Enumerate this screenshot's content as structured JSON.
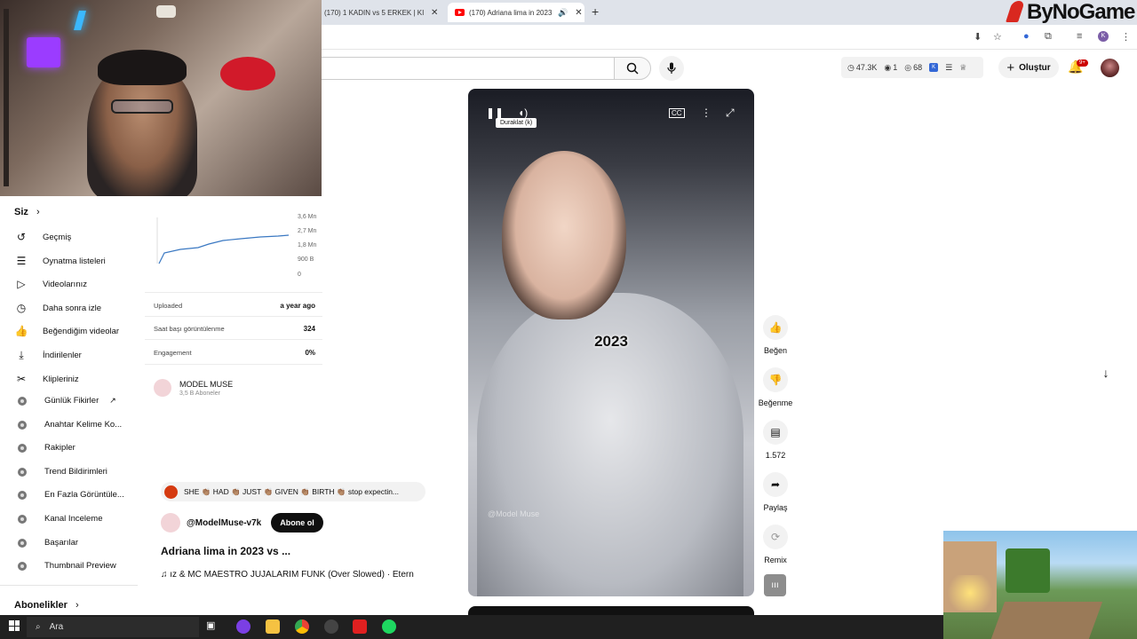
{
  "browser": {
    "tabs": [
      {
        "label": "(170) 1 KADIN vs 5 ERKEK | KIYA"
      },
      {
        "label": "(170) Adriana lima in 2023"
      }
    ],
    "new_tab": "+",
    "brand": "ByNoGame"
  },
  "header": {
    "stats": {
      "views": "47.3K",
      "a": "1",
      "b": "68"
    },
    "create_label": "Oluştur",
    "notif_badge": "9+"
  },
  "sidebar": {
    "you_label": "Siz",
    "items": [
      {
        "label": "Geçmiş",
        "icon": "history-icon"
      },
      {
        "label": "Oynatma listeleri",
        "icon": "playlist-icon"
      },
      {
        "label": "Videolarınız",
        "icon": "video-icon"
      },
      {
        "label": "Daha sonra izle",
        "icon": "clock-icon"
      },
      {
        "label": "Beğendiğim videolar",
        "icon": "thumbs-up-icon"
      },
      {
        "label": "İndirilenler",
        "icon": "download-icon"
      },
      {
        "label": "Klipleriniz",
        "icon": "scissors-icon"
      }
    ],
    "ext_items": [
      {
        "label": "Günlük Fikirler"
      },
      {
        "label": "Anahtar Kelime Ko..."
      },
      {
        "label": "Rakipler"
      },
      {
        "label": "Trend Bildirimleri"
      },
      {
        "label": "En Fazla Görüntüle..."
      },
      {
        "label": "Kanal Inceleme"
      },
      {
        "label": "Başarılar"
      },
      {
        "label": "Thumbnail Preview"
      }
    ],
    "subs_label": "Abonelikler"
  },
  "panel": {
    "chart_ticks": [
      "3,6 Mn",
      "2,7 Mn",
      "1,8 Mn",
      "900 B",
      "0"
    ],
    "rows": [
      {
        "label": "Uploaded",
        "value": "a year ago"
      },
      {
        "label": "Saat başı görüntülenme",
        "value": "324"
      },
      {
        "label": "Engagement",
        "value": "0%"
      }
    ],
    "channel": {
      "name": "MODEL MUSE",
      "subs": "3,5 B Aboneler"
    }
  },
  "video": {
    "tooltip": "Duraklat (k)",
    "caption": "2023",
    "watermark": "@Model Muse"
  },
  "actions": [
    {
      "label": "Beğen",
      "icon": "thumbs-up-icon"
    },
    {
      "label": "Beğenme",
      "icon": "thumbs-down-icon"
    },
    {
      "label": "1.572",
      "icon": "comment-icon"
    },
    {
      "label": "Paylaş",
      "icon": "share-icon"
    },
    {
      "label": "Remix",
      "icon": "remix-icon"
    }
  ],
  "meta": {
    "music_text": "SHE 👏🏽 HAD 👏🏽 JUST 👏🏽 GIVEN 👏🏽 BIRTH 👏🏽 stop expectin...",
    "handle": "@ModelMuse-v7k",
    "subscribe": "Abone ol",
    "title": "Adriana lima in 2023 vs ...",
    "track": "♫ ız & MC MAESTRO    JUJALARIM FUNK (Over Slowed) · Etern"
  },
  "taskbar": {
    "search_placeholder": "Ara"
  }
}
